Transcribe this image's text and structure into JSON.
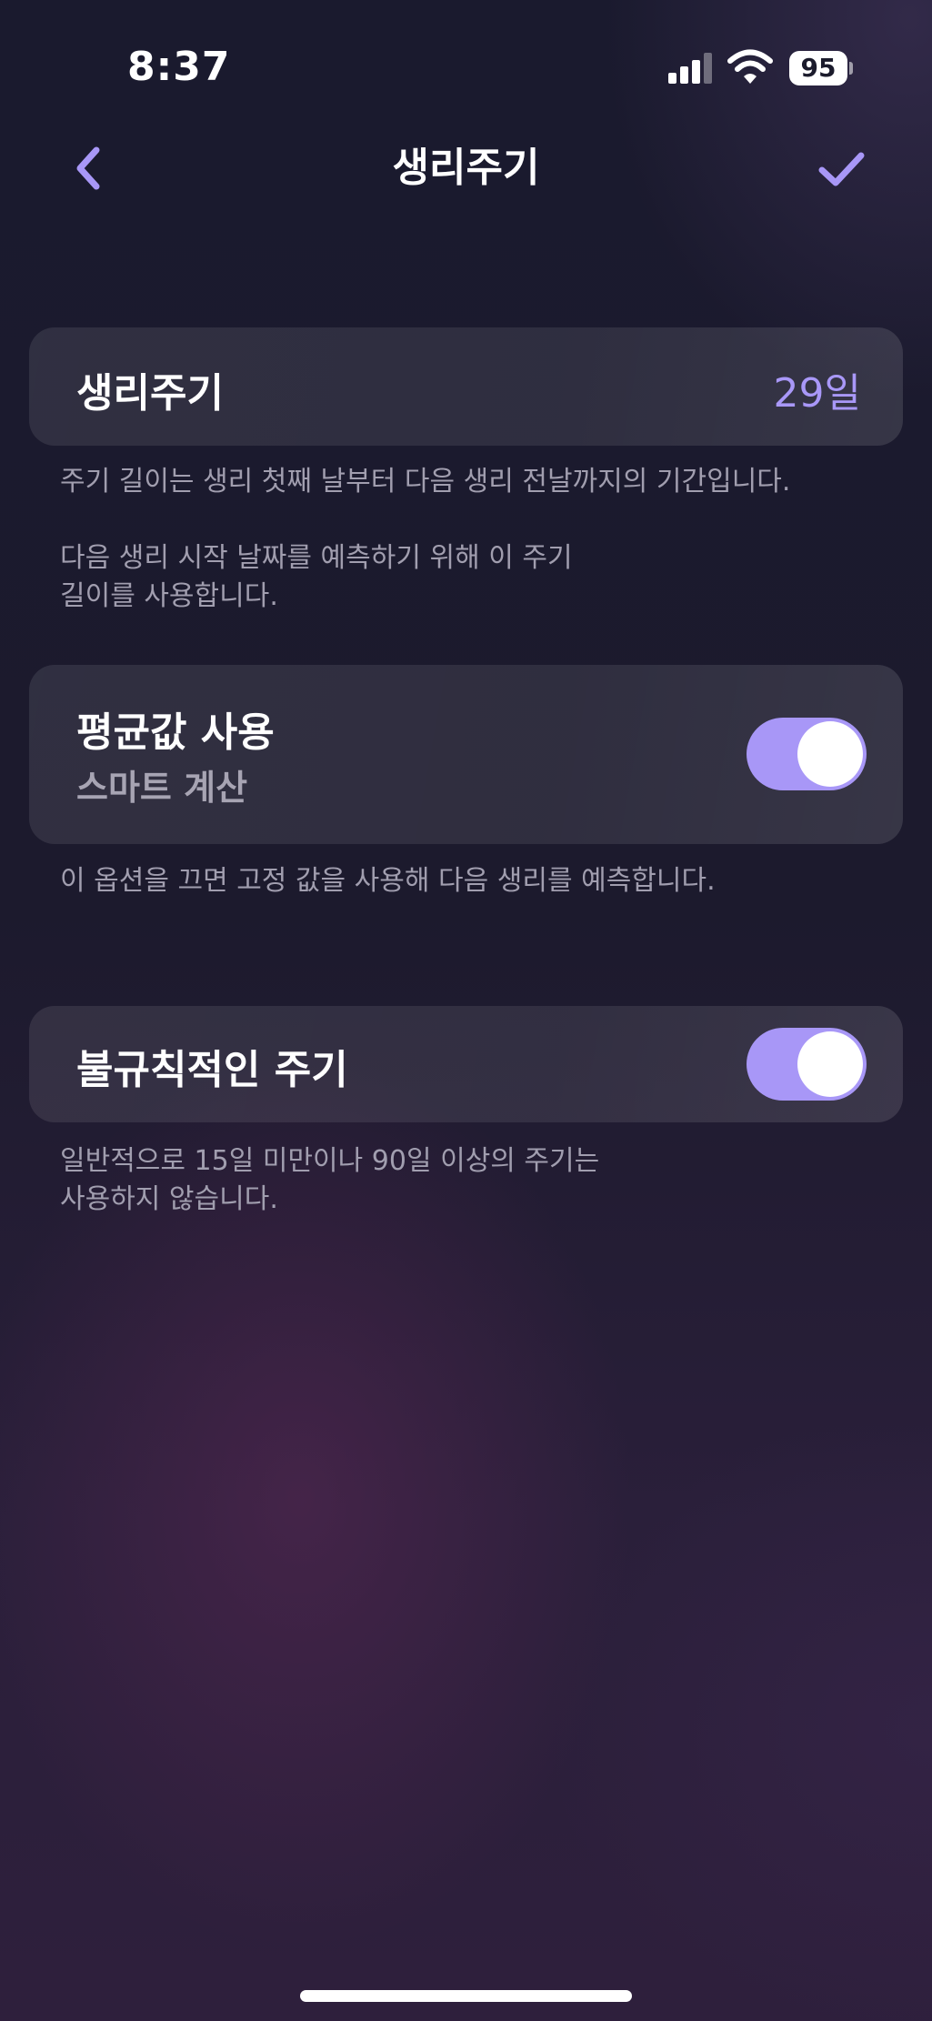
{
  "status_bar": {
    "time": "8:37",
    "battery": "95",
    "icons": [
      "cellular-signal-icon",
      "wifi-icon",
      "battery-icon"
    ]
  },
  "nav": {
    "title": "생리주기",
    "back_icon": "chevron-left-icon",
    "done_icon": "checkmark-icon"
  },
  "cycle_length": {
    "label": "생리주기",
    "value": "29일",
    "description": "주기 길이는 생리 첫째 날부터 다음 생리 전날까지의 기간입니다.\n\n다음 생리 시작 날짜를 예측하기 위해 이 주기\n길이를 사용합니다."
  },
  "use_average": {
    "label": "평균값 사용",
    "sublabel": "스마트 계산",
    "enabled": true,
    "description": "이 옵션을 끄면 고정 값을 사용해 다음 생리를 예측합니다."
  },
  "irregular_cycle": {
    "label": "불규칙적인 주기",
    "enabled": true,
    "description": "일반적으로 15일 미만이나 90일 이상의 주기는\n사용하지 않습니다."
  },
  "colors": {
    "accent": "#a897f7",
    "background": "#1c1a2d",
    "card": "#2c2a3d",
    "secondary_text": "#a19eaf"
  }
}
